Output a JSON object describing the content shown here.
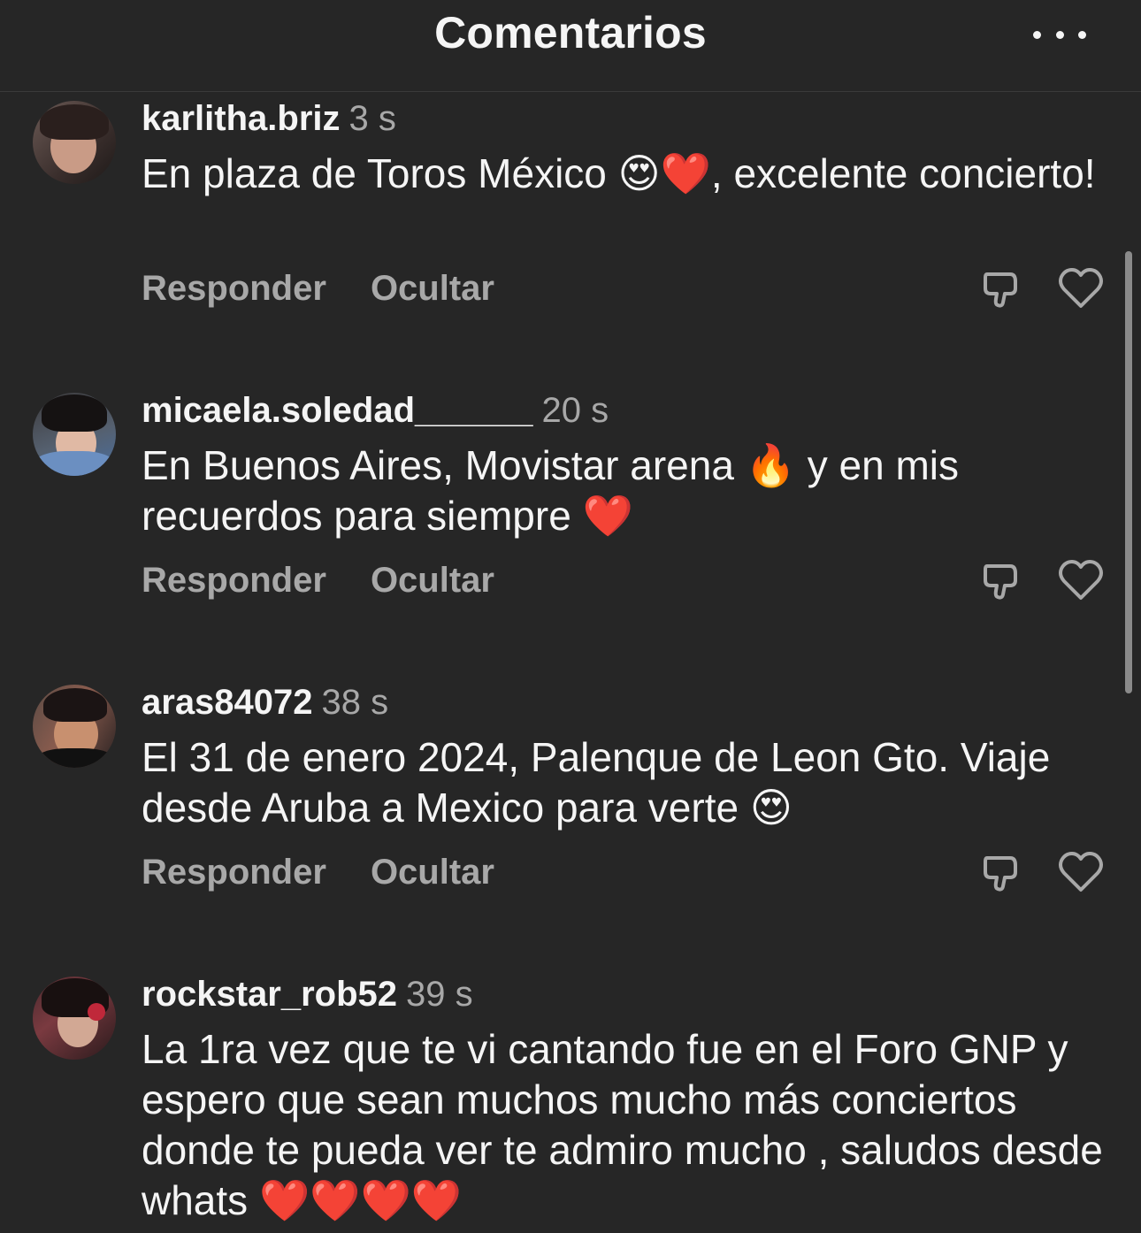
{
  "header": {
    "title": "Comentarios",
    "more_icon": "ellipsis-icon"
  },
  "actions": {
    "reply": "Responder",
    "hide": "Ocultar"
  },
  "comments": [
    {
      "username": "karlitha.briz",
      "time": "3 s",
      "text": "En plaza de Toros México 😍❤️, excelente concierto!"
    },
    {
      "username": "micaela.soledad______",
      "time": "20 s",
      "text": "En Buenos Aires, Movistar arena 🔥 y en mis recuerdos para siempre ❤️"
    },
    {
      "username": "aras84072",
      "time": "38 s",
      "text": "El 31 de enero 2024, Palenque de Leon Gto. Viaje desde Aruba a Mexico para verte 😍"
    },
    {
      "username": "rockstar_rob52",
      "time": "39 s",
      "text": "La 1ra vez que te vi cantando fue en el Foro GNP y espero que sean muchos mucho más conciertos donde te pueda ver te admiro mucho , saludos desde whats ❤️❤️❤️❤️"
    }
  ],
  "colors": {
    "background": "#262626",
    "primary_text": "#f5f5f5",
    "secondary_text": "#a8a8a8"
  }
}
